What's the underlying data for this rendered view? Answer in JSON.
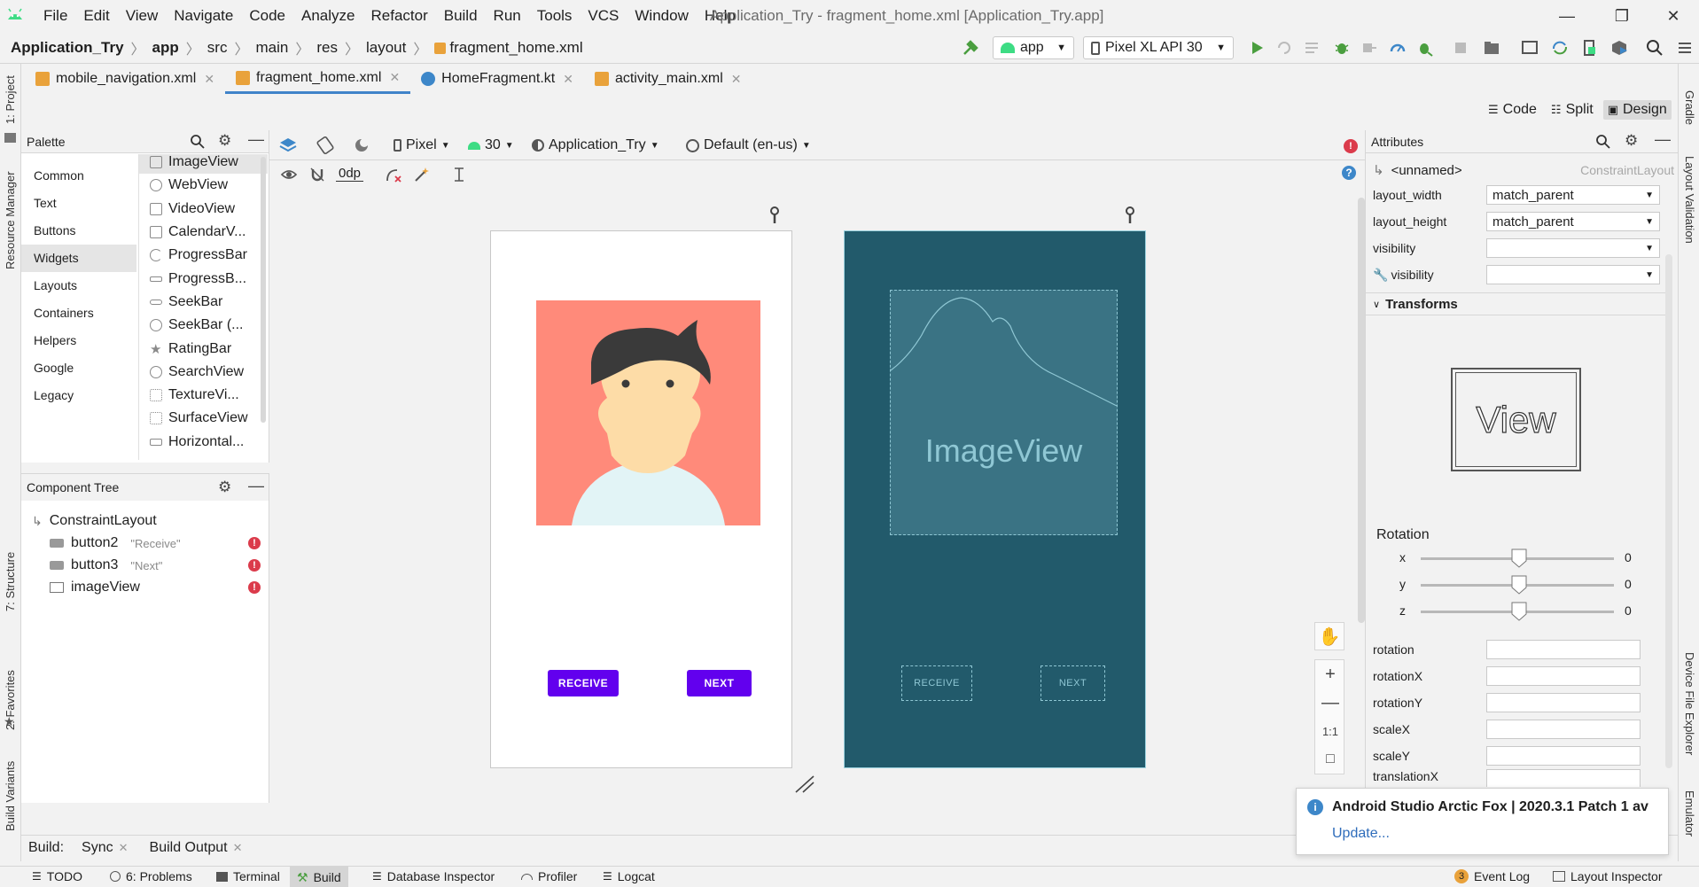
{
  "menubar": {
    "items": [
      "File",
      "Edit",
      "View",
      "Navigate",
      "Code",
      "Analyze",
      "Refactor",
      "Build",
      "Run",
      "Tools",
      "VCS",
      "Window",
      "Help"
    ],
    "window_title": "Application_Try - fragment_home.xml [Application_Try.app]"
  },
  "breadcrumb": [
    "Application_Try",
    "app",
    "src",
    "main",
    "res",
    "layout",
    "fragment_home.xml"
  ],
  "run": {
    "config": "app",
    "device": "Pixel XL API 30"
  },
  "editor_tabs": [
    {
      "label": "mobile_navigation.xml",
      "active": false
    },
    {
      "label": "fragment_home.xml",
      "active": true
    },
    {
      "label": "HomeFragment.kt",
      "active": false
    },
    {
      "label": "activity_main.xml",
      "active": false
    }
  ],
  "modes": {
    "code": "Code",
    "split": "Split",
    "design": "Design"
  },
  "left_stripe": {
    "project": "1: Project",
    "resource_manager": "Resource Manager",
    "structure": "7: Structure",
    "favorites": "2: Favorites",
    "build_variants": "Build Variants"
  },
  "right_stripe": {
    "gradle": "Gradle",
    "layout_validation": "Layout Validation",
    "device_file_explorer": "Device File Explorer",
    "emulator": "Emulator"
  },
  "palette": {
    "title": "Palette",
    "categories": [
      "Common",
      "Text",
      "Buttons",
      "Widgets",
      "Layouts",
      "Containers",
      "Helpers",
      "Google",
      "Legacy"
    ],
    "selected": "Widgets",
    "items": [
      "ImageView",
      "WebView",
      "VideoView",
      "CalendarV...",
      "ProgressBar",
      "ProgressB...",
      "SeekBar",
      "SeekBar (...",
      "RatingBar",
      "SearchView",
      "TextureVi...",
      "SurfaceView",
      "Horizontal..."
    ]
  },
  "component_tree": {
    "title": "Component Tree",
    "root": "ConstraintLayout",
    "children": [
      {
        "id": "button2",
        "hint": "\"Receive\""
      },
      {
        "id": "button3",
        "hint": "\"Next\""
      },
      {
        "id": "imageView",
        "hint": ""
      }
    ]
  },
  "design_toolbar": {
    "device": "Pixel",
    "api": "30",
    "theme": "Application_Try",
    "locale": "Default (en-us)",
    "margin": "0dp"
  },
  "preview": {
    "receive_label": "RECEIVE",
    "next_label": "NEXT",
    "imageview_label": "ImageView"
  },
  "zoom": {
    "one_to_one": "1:1"
  },
  "attributes": {
    "title": "Attributes",
    "element": "<unnamed>",
    "element_type": "ConstraintLayout",
    "layout_width_label": "layout_width",
    "layout_width": "match_parent",
    "layout_height_label": "layout_height",
    "layout_height": "match_parent",
    "visibility_label": "visibility",
    "tools_visibility_label": "visibility",
    "transforms_label": "Transforms",
    "view_preview": "View",
    "rotation_label": "Rotation",
    "rotation": {
      "x": "0",
      "y": "0",
      "z": "0"
    },
    "fields": [
      "rotation",
      "rotationX",
      "rotationY",
      "scaleX",
      "scaleY",
      "translationX"
    ]
  },
  "build_bar": {
    "label": "Build:",
    "tabs": [
      "Sync",
      "Build Output"
    ]
  },
  "notification": {
    "title": "Android Studio Arctic Fox | 2020.3.1 Patch 1 av",
    "link": "Update..."
  },
  "statusbar": {
    "todo": "TODO",
    "problems": "6: Problems",
    "terminal": "Terminal",
    "build": "Build",
    "database": "Database Inspector",
    "profiler": "Profiler",
    "logcat": "Logcat",
    "event_log_count": "3",
    "event_log": "Event Log",
    "layout_inspector": "Layout Inspector"
  },
  "colors": {
    "accent_tab": "#4083c9",
    "button_purple": "#6200ee",
    "blueprint_bg": "#225a6b",
    "avatar_bg": "#ff8a7a",
    "error": "#db3b4b",
    "run_green": "#4a9e3f"
  }
}
